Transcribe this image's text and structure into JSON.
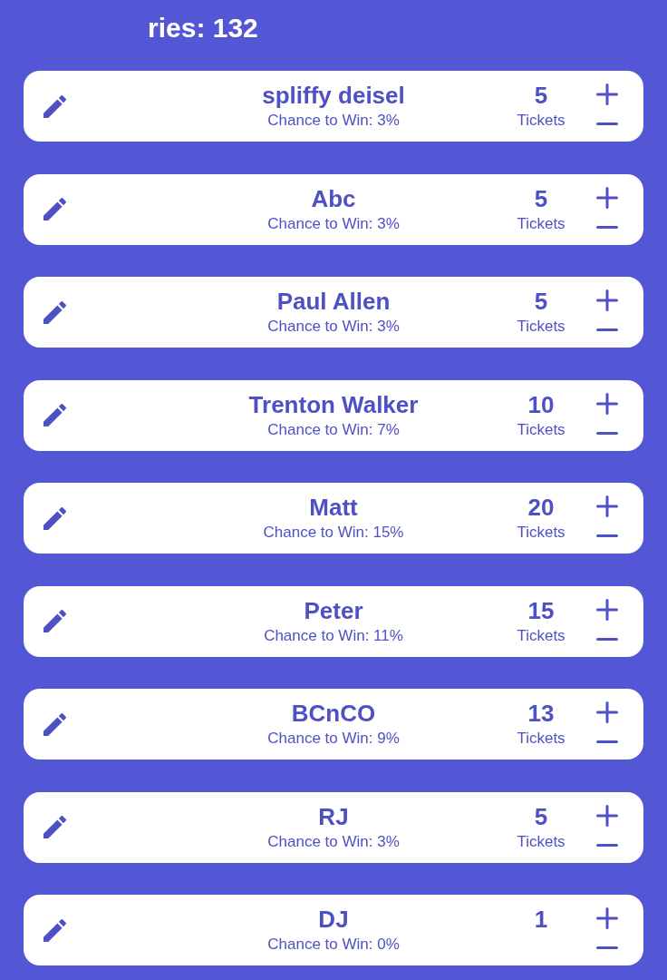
{
  "header": {
    "title": "ries: 132"
  },
  "entries": [
    {
      "name": "spliffy deisel",
      "chance": "Chance to Win: 3%",
      "tickets": "5",
      "tickets_label": "Tickets"
    },
    {
      "name": "Abc",
      "chance": "Chance to Win: 3%",
      "tickets": "5",
      "tickets_label": "Tickets"
    },
    {
      "name": "Paul Allen",
      "chance": "Chance to Win: 3%",
      "tickets": "5",
      "tickets_label": "Tickets"
    },
    {
      "name": "Trenton Walker",
      "chance": "Chance to Win: 7%",
      "tickets": "10",
      "tickets_label": "Tickets"
    },
    {
      "name": "Matt",
      "chance": "Chance to Win: 15%",
      "tickets": "20",
      "tickets_label": "Tickets"
    },
    {
      "name": "Peter",
      "chance": "Chance to Win: 11%",
      "tickets": "15",
      "tickets_label": "Tickets"
    },
    {
      "name": "BCnCO",
      "chance": "Chance to Win: 9%",
      "tickets": "13",
      "tickets_label": "Tickets"
    },
    {
      "name": "RJ",
      "chance": "Chance to Win: 3%",
      "tickets": "5",
      "tickets_label": "Tickets"
    },
    {
      "name": "DJ",
      "chance": "Chance to Win: 0%",
      "tickets": "1"
    }
  ]
}
